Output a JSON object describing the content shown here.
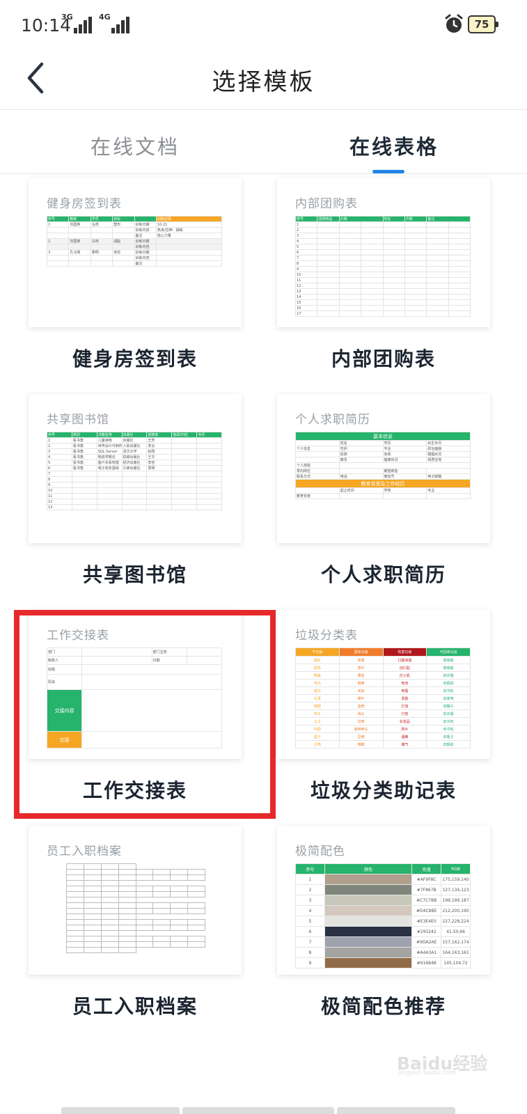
{
  "status_bar": {
    "time": "10:14",
    "net1": "3G",
    "net2": "4G",
    "battery": "75"
  },
  "header": {
    "title": "选择模板"
  },
  "tabs": [
    {
      "label": "在线文档",
      "active": false
    },
    {
      "label": "在线表格",
      "active": true
    }
  ],
  "accent_color": "#1f86e8",
  "selection_color": "#e6292b",
  "templates": [
    {
      "preview_title": "健身房签到表",
      "label": "健身房签到表"
    },
    {
      "preview_title": "内部团购表",
      "label": "内部团购表"
    },
    {
      "preview_title": "共享图书馆",
      "label": "共享图书馆"
    },
    {
      "preview_title": "个人求职简历",
      "label": "个人求职简历"
    },
    {
      "preview_title": "工作交接表",
      "label": "工作交接表",
      "selected": true
    },
    {
      "preview_title": "垃圾分类表",
      "label": "垃圾分类助记表"
    },
    {
      "preview_title": "员工入职档案",
      "label": "员工入职档案"
    },
    {
      "preview_title": "极简配色",
      "label": "极简配色推荐"
    }
  ],
  "previews": {
    "gym": {
      "headers": [
        "序号",
        "教练",
        "学员",
        "目标",
        "",
        "训练记录"
      ],
      "rows": [
        [
          "1",
          "刘国英",
          "马亮",
          "塑形",
          "训练日期",
          "10.21"
        ],
        [
          "",
          "",
          "",
          "",
          "训练内容",
          "热身/拉伸：跳绳"
        ],
        [
          "",
          "",
          "",
          "",
          "备注",
          "核心力量"
        ],
        [
          "2",
          "刘国英",
          "冯林",
          "减脂",
          "训练日期",
          ""
        ],
        [
          "",
          "",
          "",
          "",
          "训练内容",
          ""
        ],
        [
          "3",
          "孔令刚",
          "黎明",
          "体态",
          "训练日期",
          ""
        ],
        [
          "",
          "",
          "",
          "",
          "训练内容",
          ""
        ],
        [
          "",
          "",
          "",
          "",
          "备注",
          ""
        ]
      ]
    },
    "group_buy": {
      "headers": [
        "序号",
        "团购物品",
        "价格",
        "地址",
        "件数",
        "备注"
      ],
      "rows": [
        "1",
        "2",
        "3",
        "4",
        "5",
        "6",
        "7",
        "8",
        "9",
        "10",
        "11",
        "12",
        "13",
        "14",
        "15",
        "16",
        "17"
      ]
    },
    "library": {
      "headers": [
        "序号",
        "类别",
        "书籍名称",
        "出版社",
        "捐赠者",
        "借阅/归还",
        "书评"
      ],
      "rows": [
        [
          "1",
          "看书角",
          "儿童读物",
          "出版社",
          "王芳",
          "",
          ""
        ],
        [
          "2",
          "看书角",
          "世界设计与制作",
          "人民出版社",
          "李云",
          "",
          ""
        ],
        [
          "3",
          "看书角",
          "SQL Server",
          "清华大学",
          "赵刚",
          "",
          ""
        ],
        [
          "4",
          "看书角",
          "物流学概论",
          "机械出版社",
          "王华",
          "",
          ""
        ],
        [
          "5",
          "看书角",
          "客户关系管理",
          "经济出版社",
          "李佳",
          "",
          ""
        ],
        [
          "6",
          "看书角",
          "电子商务基础",
          "江西出版社",
          "周明",
          "",
          ""
        ],
        [
          "7",
          "",
          "",
          "",
          "",
          "",
          ""
        ],
        [
          "8",
          "",
          "",
          "",
          "",
          "",
          ""
        ],
        [
          "9",
          "",
          "",
          "",
          "",
          "",
          ""
        ],
        [
          "10",
          "",
          "",
          "",
          "",
          "",
          ""
        ],
        [
          "11",
          "",
          "",
          "",
          "",
          "",
          ""
        ],
        [
          "12",
          "",
          "",
          "",
          "",
          "",
          ""
        ],
        [
          "13",
          "",
          "",
          "",
          "",
          "",
          ""
        ]
      ]
    },
    "resume": {
      "section1": "基本信息",
      "section2": "教育背景及工作经历",
      "rows": [
        [
          "",
          "姓名",
          "学历",
          "出生年月"
        ],
        [
          "个人信息",
          "性别",
          "专业",
          "政治面貌"
        ],
        [
          "",
          "民族",
          "身高",
          "婚姻状况"
        ],
        [
          "",
          "籍贯",
          "健康状况",
          "现居住地"
        ],
        [
          "个人技能",
          "",
          "",
          ""
        ],
        [
          "意向岗位",
          "",
          "期望薪金",
          ""
        ],
        [
          "联系方式",
          "电话",
          "微信号",
          "电子邮箱"
        ]
      ],
      "edu_row": [
        "",
        "起止时间",
        "学校",
        "专业"
      ],
      "edu_label": "教育背景"
    },
    "handover": {
      "row1": [
        "部门",
        "",
        "部门主管",
        ""
      ],
      "row2": [
        "制表人",
        "",
        "日期",
        ""
      ],
      "rows": [
        "标题",
        "原由"
      ],
      "green_label": "交接内容",
      "orange_label": "交接"
    },
    "garbage": {
      "headers": [
        "干垃圾",
        "厨余垃圾",
        "有害垃圾",
        "可回收垃圾"
      ],
      "header_colors": [
        "#f5a623",
        "#f07c2b",
        "#b0171c",
        "#26b36b"
      ],
      "rows": [
        [
          "烟头",
          "饭菜",
          "口服液瓶",
          "玻璃瓶"
        ],
        [
          "尿布",
          "茶叶",
          "创口贴",
          "玻璃瓶"
        ],
        [
          "陶瓷",
          "果皮",
          "打火机",
          "旧衣服"
        ],
        [
          "毛巾",
          "剩菜",
          "电池",
          "旧报纸"
        ],
        [
          "纸巾",
          "米饭",
          "电瓶",
          "旧书包"
        ],
        [
          "头发",
          "菜叶",
          "发胶",
          "旧家电"
        ],
        [
          "拖把",
          "蛋壳",
          "灯泡",
          "旧罐子"
        ],
        [
          "杯子",
          "骨头",
          "灯管",
          "旧衣服"
        ],
        [
          "尘土",
          "甘蔗",
          "化妆品",
          "旧书包"
        ],
        [
          "扫把",
          "各种骨头",
          "药片",
          "旧书包"
        ],
        [
          "盒子",
          "豆壳",
          "酒精",
          "旧瓶子"
        ],
        [
          "贝壳",
          "辣椒",
          "爆气",
          "旧报纸"
        ]
      ]
    },
    "staff": {
      "title": "员工入职档案"
    },
    "colors": {
      "headers": [
        "序号",
        "颜色",
        "色值",
        "RGB"
      ],
      "rows": [
        {
          "n": "1",
          "hex": "#AF9F8C",
          "rgb": "175,159,140"
        },
        {
          "n": "2",
          "hex": "#7F867B",
          "rgb": "127,134,123"
        },
        {
          "n": "3",
          "hex": "#C7C7BB",
          "rgb": "199,199,187"
        },
        {
          "n": "4",
          "hex": "#D4C8BE",
          "rgb": "212,200,190"
        },
        {
          "n": "5",
          "hex": "#E3E4E0",
          "rgb": "227,228,224"
        },
        {
          "n": "6",
          "hex": "#293242",
          "rgb": "41,50,66"
        },
        {
          "n": "7",
          "hex": "#9DA2AE",
          "rgb": "157,162,174"
        },
        {
          "n": "8",
          "hex": "#A4A3A1",
          "rgb": "164,163,161"
        },
        {
          "n": "9",
          "hex": "#916B48",
          "rgb": "145,104,72"
        }
      ]
    }
  },
  "watermark": {
    "text": "Baidu经验",
    "sub": "jingyan.baidu.com"
  }
}
